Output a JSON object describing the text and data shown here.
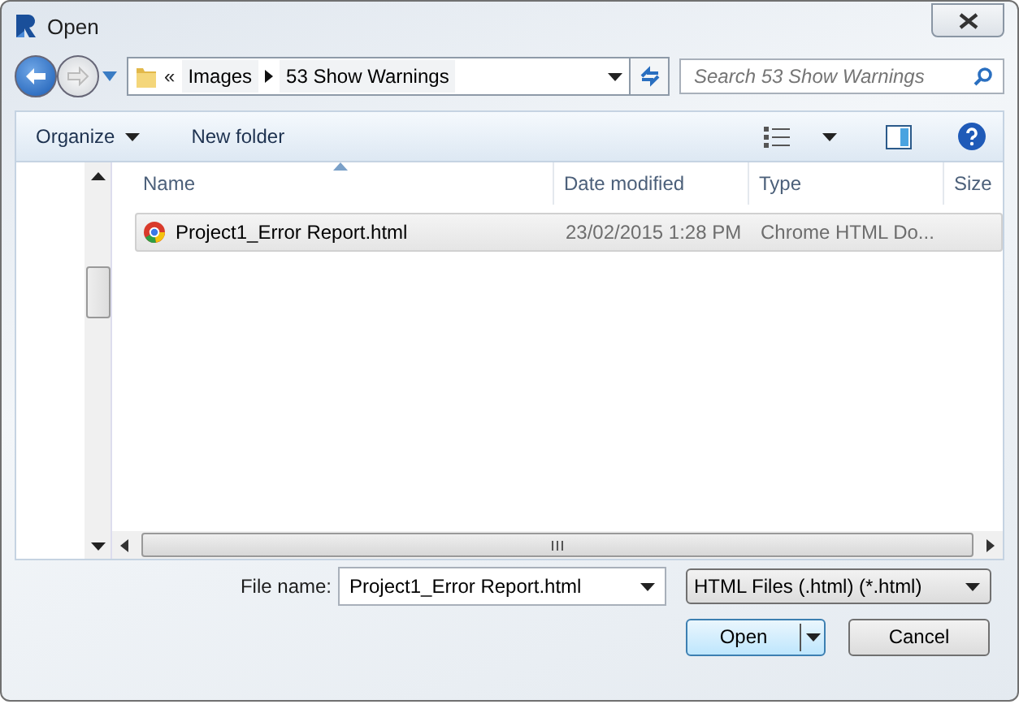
{
  "window": {
    "title": "Open"
  },
  "address": {
    "overflow": "«",
    "crumbs": [
      "Images",
      "53 Show Warnings"
    ]
  },
  "search": {
    "placeholder": "Search 53 Show Warnings"
  },
  "toolbar": {
    "organize": "Organize",
    "new_folder": "New folder"
  },
  "table": {
    "columns": [
      "Name",
      "Date modified",
      "Type",
      "Size"
    ],
    "rows": [
      {
        "name": "Project1_Error Report.html",
        "date": "23/02/2015 1:28 PM",
        "type": "Chrome HTML Do...",
        "selected": true
      }
    ]
  },
  "file_name": {
    "label": "File name:",
    "value": "Project1_Error Report.html"
  },
  "filter": {
    "value": "HTML Files (.html) (*.html)"
  },
  "buttons": {
    "open": "Open",
    "cancel": "Cancel"
  }
}
